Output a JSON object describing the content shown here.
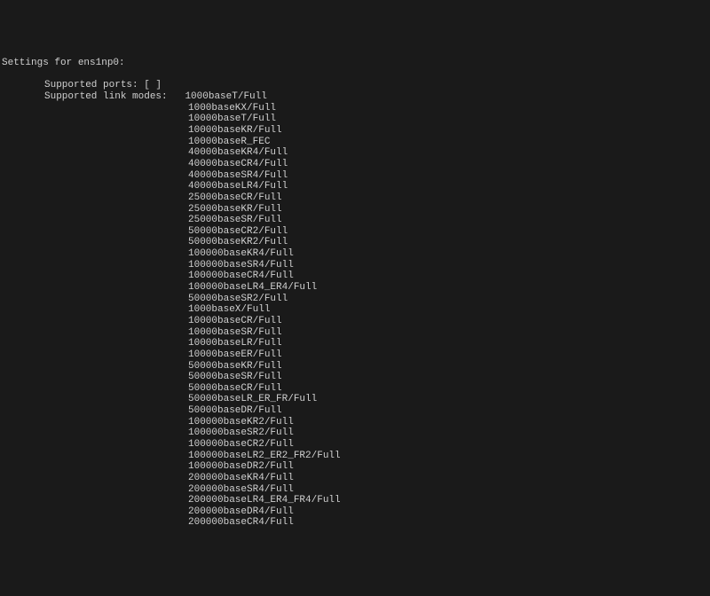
{
  "header": "Settings for ens1np0:",
  "supported_ports_label": "Supported ports: [ ]",
  "supported_link_modes_label": "Supported link modes:   ",
  "link_modes": [
    "1000baseT/Full",
    "1000baseKX/Full",
    "10000baseT/Full",
    "10000baseKR/Full",
    "10000baseR_FEC",
    "40000baseKR4/Full",
    "40000baseCR4/Full",
    "40000baseSR4/Full",
    "40000baseLR4/Full",
    "25000baseCR/Full",
    "25000baseKR/Full",
    "25000baseSR/Full",
    "50000baseCR2/Full",
    "50000baseKR2/Full",
    "100000baseKR4/Full",
    "100000baseSR4/Full",
    "100000baseCR4/Full",
    "100000baseLR4_ER4/Full",
    "50000baseSR2/Full",
    "1000baseX/Full",
    "10000baseCR/Full",
    "10000baseSR/Full",
    "10000baseLR/Full",
    "10000baseER/Full",
    "50000baseKR/Full",
    "50000baseSR/Full",
    "50000baseCR/Full",
    "50000baseLR_ER_FR/Full",
    "50000baseDR/Full",
    "100000baseKR2/Full",
    "100000baseSR2/Full",
    "100000baseCR2/Full",
    "100000baseLR2_ER2_FR2/Full",
    "100000baseDR2/Full",
    "200000baseKR4/Full",
    "200000baseSR4/Full",
    "200000baseLR4_ER4_FR4/Full",
    "200000baseDR4/Full",
    "200000baseCR4/Full"
  ]
}
